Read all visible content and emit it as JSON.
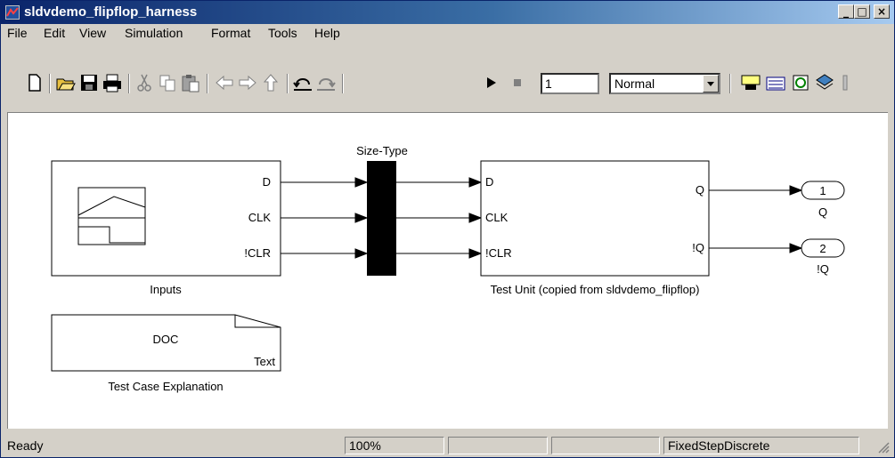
{
  "window": {
    "title": "sldvdemo_flipflop_harness"
  },
  "title_buttons": {
    "minimize": "_",
    "maximize": "□",
    "close": "×"
  },
  "menu": [
    "File",
    "Edit",
    "View",
    "Simulation",
    "Format",
    "Tools",
    "Help"
  ],
  "toolbar": {
    "icons": [
      "new-model-icon",
      "open-icon",
      "save-icon",
      "print-icon",
      "cut-icon",
      "copy-icon",
      "paste-icon",
      "back-icon",
      "forward-icon",
      "up-level-icon",
      "undo-icon",
      "redo-icon",
      "start-simulation-icon",
      "stop-simulation-icon",
      "build-icon",
      "update-diagram-icon",
      "refresh-icon",
      "library-browser-icon"
    ],
    "stop_time": "1",
    "sim_mode": "Normal"
  },
  "diagram": {
    "inputs_block": {
      "name": "Inputs",
      "ports": [
        "D",
        "CLK",
        "!CLR"
      ]
    },
    "mux_block": {
      "name": "Size-Type"
    },
    "test_unit": {
      "name": "Test Unit (copied from sldvdemo_flipflop)",
      "in_ports": [
        "D",
        "CLK",
        "!CLR"
      ],
      "out_ports": [
        "Q",
        "!Q"
      ]
    },
    "outport_1": {
      "number": "1",
      "name": "Q"
    },
    "outport_2": {
      "number": "2",
      "name": "!Q"
    },
    "doc_block": {
      "label": "DOC",
      "type": "Text",
      "name": "Test Case Explanation"
    }
  },
  "status": {
    "state": "Ready",
    "zoom": "100%",
    "cell3": "",
    "cell4": "",
    "solver": "FixedStepDiscrete"
  }
}
